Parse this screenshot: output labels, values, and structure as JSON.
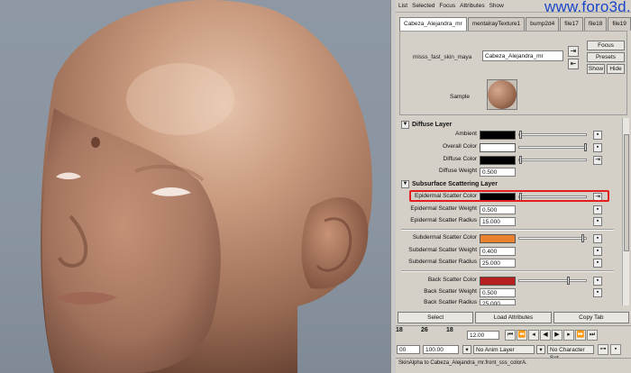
{
  "watermark": "www.foro3d.com",
  "menu": [
    "List",
    "Selected",
    "Focus",
    "Attributes",
    "Show"
  ],
  "tabs": [
    "Cabeza_Alejandra_mr",
    "mentalrayTexture1",
    "bump2d4",
    "file17",
    "file18",
    "file19"
  ],
  "node": {
    "type_label": "misss_fast_skin_maya",
    "name_value": "Cabeza_Alejandra_mr",
    "focus_label": "Focus",
    "presets_label": "Presets",
    "show_label": "Show",
    "hide_label": "Hide",
    "sample_label": "Sample"
  },
  "sections": {
    "diffuse_title": "Diffuse Layer",
    "sss_title": "Subsurface Scattering Layer"
  },
  "attributes": {
    "ambient": {
      "label": "Ambient",
      "color": "#000000",
      "slider": 0.02
    },
    "overall_color": {
      "label": "Overall Color",
      "color": "#ffffff",
      "slider": 0.98
    },
    "diffuse_color": {
      "label": "Diffuse Color",
      "color": "#000000",
      "slider": 0.02
    },
    "diffuse_weight": {
      "label": "Diffuse Weight",
      "value": "0.500"
    },
    "epi_color": {
      "label": "Epidermal Scatter Color",
      "color": "#000000",
      "slider": 0.02
    },
    "epi_weight": {
      "label": "Epidermal Scatter Weight",
      "value": "0.500"
    },
    "epi_radius": {
      "label": "Epidermal Scatter Radius",
      "value": "15.000"
    },
    "sub_color": {
      "label": "Subdermal Scatter Color",
      "color": "#e8822e",
      "slider": 0.93
    },
    "sub_weight": {
      "label": "Subdermal Scatter Weight",
      "value": "0.400"
    },
    "sub_radius": {
      "label": "Subdermal Scatter Radius",
      "value": "25.000"
    },
    "back_color": {
      "label": "Back Scatter Color",
      "color": "#b82020",
      "slider": 0.72
    },
    "back_weight": {
      "label": "Back Scatter Weight",
      "value": "0.500"
    },
    "back_radius": {
      "label": "Back Scatter Radius",
      "value": "25.000"
    }
  },
  "buttons": {
    "select": "Select",
    "load": "Load Attributes",
    "copy": "Copy Tab"
  },
  "timeline": {
    "tick_a": "26",
    "tick_b": "18",
    "current_time": "12.00",
    "range_start": "00",
    "range_end": "100.00",
    "anim_layer": "No Anim Layer",
    "character_set": "No Character Set"
  },
  "status": "SkinAlpha to Cabeza_Alejandra_mr.front_sss_colorA."
}
